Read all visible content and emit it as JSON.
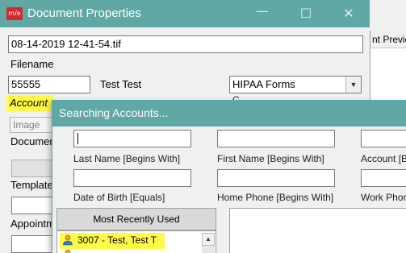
{
  "doc_props": {
    "app_icon_text": "m/e",
    "title": "Document Properties",
    "window_controls": {
      "minimize": "—",
      "maximize": "☐",
      "close": "✕"
    },
    "right_pane_header": "nt Previe",
    "filename_value": "08-14-2019 12-41-54.tif",
    "filename_label": "Filename",
    "account_value": "55555",
    "account_name": "Test Test",
    "doc_type_value": "HIPAA Forms",
    "cut_label": "C",
    "account_label": "Account",
    "image_value": "Image",
    "document_label": "Documen",
    "template_label": "Template",
    "appointment_label": "Appointm"
  },
  "search": {
    "title": "Searching Accounts...",
    "last_name_label": "Last Name [Begins With]",
    "first_name_label": "First Name [Begins With]",
    "account_label": "Account [Be",
    "dob_label": "Date of Birth [Equals]",
    "home_phone_label": "Home Phone [Begins With]",
    "work_phone_label": "Work Phon",
    "mru_header": "Most Recently Used",
    "mru_items": [
      {
        "text": "3007 - Test, Test T",
        "icon": "person-icon"
      },
      {
        "text": "",
        "icon": "person-icon"
      }
    ],
    "scroll_up": "▲"
  },
  "colors": {
    "titlebar": "#5fa8a6",
    "highlight": "#fffb46",
    "app_icon": "#d6262e"
  }
}
